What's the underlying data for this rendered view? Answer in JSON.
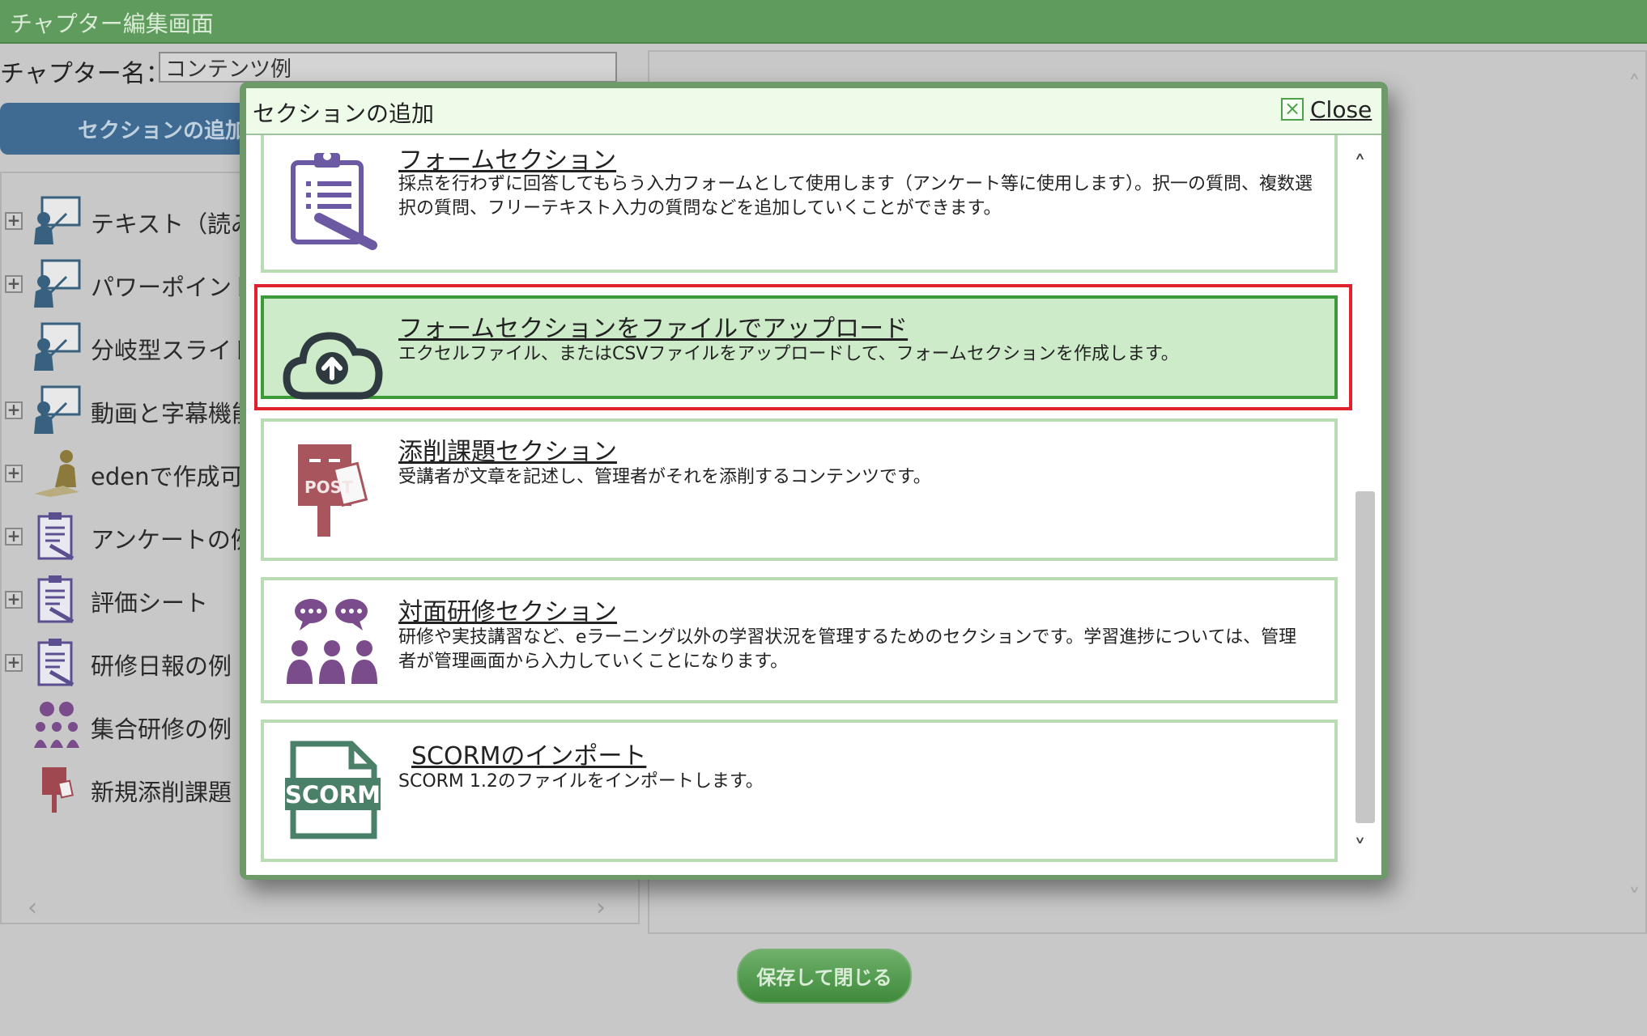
{
  "window": {
    "title": "チャプター編集画面"
  },
  "chapter": {
    "label": "チャプター名：",
    "value": "コンテンツ例"
  },
  "toolbar": {
    "add_section_label": "セクションの追加",
    "save_close_label": "保存して閉じる"
  },
  "tree": {
    "items": [
      {
        "label": "テキスト（読み",
        "icon": "presenter-icon",
        "expandable": true
      },
      {
        "label": "パワーポイント",
        "icon": "presenter-icon",
        "expandable": true
      },
      {
        "label": "分岐型スライド",
        "icon": "presenter-icon",
        "expandable": false
      },
      {
        "label": "動画と字幕機能",
        "icon": "presenter-icon",
        "expandable": true
      },
      {
        "label": "edenで作成可能",
        "icon": "writer-icon",
        "expandable": true
      },
      {
        "label": "アンケートの例",
        "icon": "clipboard-icon",
        "expandable": true
      },
      {
        "label": "評価シート",
        "icon": "clipboard-icon",
        "expandable": true
      },
      {
        "label": "研修日報の例",
        "icon": "clipboard-icon",
        "expandable": true
      },
      {
        "label": "集合研修の例",
        "icon": "group-icon",
        "expandable": false
      },
      {
        "label": "新規添削課題",
        "icon": "postbox-icon",
        "expandable": false
      }
    ]
  },
  "modal": {
    "title": "セクションの追加",
    "close_label": "Close",
    "options": [
      {
        "title": "フォームセクション",
        "description": "採点を行わずに回答してもらう入力フォームとして使用します（アンケート等に使用します）。択一の質問、複数選択の質問、フリーテキスト入力の質問などを追加していくことができます。",
        "icon": "clipboard-icon",
        "selected": false
      },
      {
        "title": "フォームセクションをファイルでアップロード",
        "description": "エクセルファイル、またはCSVファイルをアップロードして、フォームセクションを作成します。",
        "icon": "cloud-upload-icon",
        "selected": true
      },
      {
        "title": "添削課題セクション",
        "description": "受講者が文章を記述し、管理者がそれを添削するコンテンツです。",
        "icon": "postbox-icon",
        "icon_text": "POST",
        "selected": false
      },
      {
        "title": "対面研修セクション",
        "description": "研修や実技講習など、eラーニング以外の学習状況を管理するためのセクションです。学習進捗については、管理者が管理画面から入力していくことになります。",
        "icon": "group-icon",
        "selected": false
      },
      {
        "title": "SCORMのインポート",
        "description": "SCORM 1.2のファイルをインポートします。",
        "icon": "scorm-file-icon",
        "icon_text": "SCORM",
        "selected": false
      }
    ]
  },
  "colors": {
    "titlebar": "#5f9b5c",
    "selected_card": "#cdebc8",
    "selected_border": "#3c9a38",
    "highlight": "#e0222e",
    "icon_purple": "#6b5aa3"
  }
}
